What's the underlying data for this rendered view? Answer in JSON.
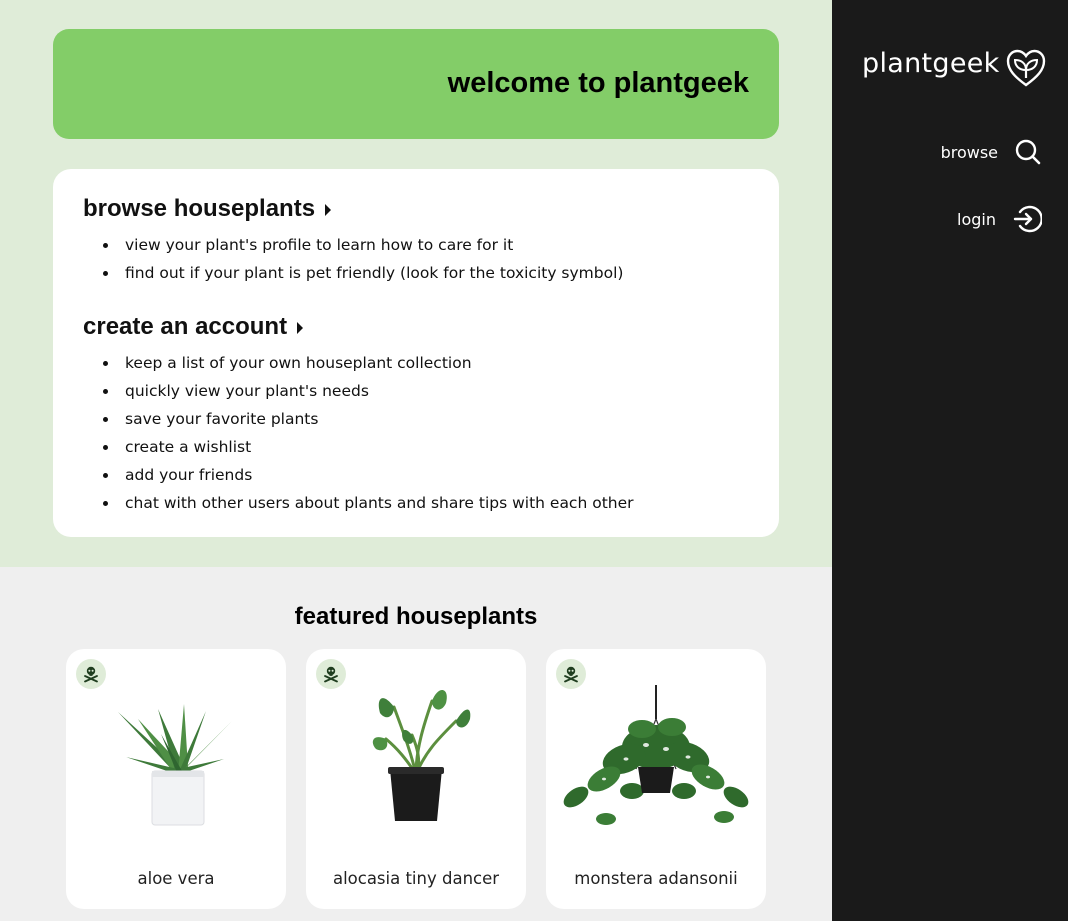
{
  "banner": {
    "title": "welcome to plantgeek"
  },
  "browse_section": {
    "heading": "browse houseplants",
    "bullets": [
      "view your plant's profile to learn how to care for it",
      "find out if your plant is pet friendly (look for the toxicity symbol)"
    ]
  },
  "account_section": {
    "heading": "create an account",
    "bullets": [
      "keep a list of your own houseplant collection",
      "quickly view your plant's needs",
      "save your favorite plants",
      "create a wishlist",
      "add your friends",
      "chat with other users about plants and share tips with each other"
    ]
  },
  "featured": {
    "title": "featured houseplants",
    "plants": [
      {
        "name": "aloe vera",
        "icon": "skull-crossbones-icon"
      },
      {
        "name": "alocasia tiny dancer",
        "icon": "skull-crossbones-icon"
      },
      {
        "name": "monstera adansonii",
        "icon": "skull-crossbones-icon"
      }
    ]
  },
  "sidebar": {
    "logo": "plantgeek",
    "logo_icon": "leaf-heart-icon",
    "nav": [
      {
        "label": "browse",
        "icon": "search-icon"
      },
      {
        "label": "login",
        "icon": "login-arrow-icon"
      }
    ]
  },
  "colors": {
    "banner_green": "#83cd68",
    "hero_bg": "#dfecd8",
    "sidebar_bg": "#1a1a1a",
    "page_bg": "#efefef"
  }
}
